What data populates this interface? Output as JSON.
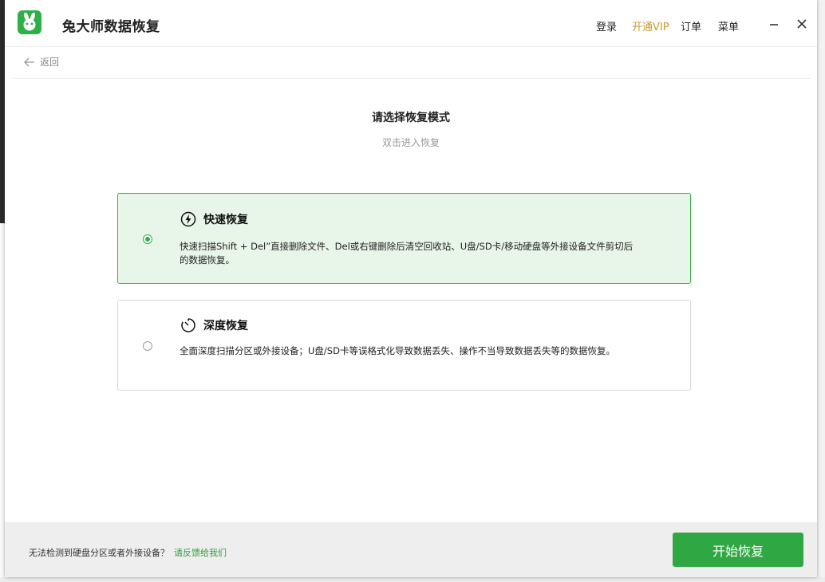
{
  "app": {
    "title": "兔大师数据恢复",
    "accent": "#2fb047"
  },
  "header": {
    "menu": [
      {
        "label": "登录"
      },
      {
        "label": "开通VIP"
      },
      {
        "label": "订单"
      },
      {
        "label": "菜单"
      }
    ]
  },
  "nav": {
    "back_label": "返回"
  },
  "main": {
    "title": "请选择恢复模式",
    "subtitle": "双击进入恢复",
    "modes": [
      {
        "title": "快速恢复",
        "icon": "lightning-icon",
        "selected": true,
        "desc_line1": "快速扫描Shift + Del”直接删除文件、Del或右键删除后清空回收站、U盘/SD卡/移动硬盘等外接设备文件剪切后",
        "desc_line2": "的数据恢复。"
      },
      {
        "title": "深度恢复",
        "icon": "timer-icon",
        "selected": false,
        "desc_line1": "全面深度扫描分区或外接设备；U盘/SD卡等误格式化导致数据丢失、操作不当导致数据丢失等的数据恢复。"
      }
    ]
  },
  "footer": {
    "hint": "无法检测到硬盘分区或者外接设备？",
    "feedback_link": "请反馈给我们",
    "start_button": "开始恢复"
  }
}
